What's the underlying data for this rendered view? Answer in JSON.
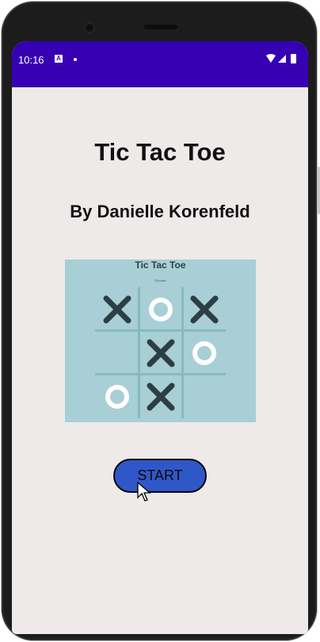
{
  "status_bar": {
    "time": "10:16",
    "notification_icon": "A",
    "icons": [
      "wifi-icon",
      "signal-icon",
      "battery-icon"
    ]
  },
  "app": {
    "title": "Tic Tac Toe",
    "subtitle": "By Danielle Korenfeld",
    "start_label": "START"
  },
  "preview": {
    "title": "Tic Tac Toe",
    "turn_text": "O's turn",
    "board": [
      "X",
      "O",
      "X",
      "",
      "X",
      "O",
      "O",
      "X",
      ""
    ]
  },
  "colors": {
    "status_bar": "#3700b3",
    "background": "#eeeae9",
    "preview_bg": "#a8cfd5",
    "mark_x": "#2d3e45",
    "mark_o": "#ffffff",
    "start_button": "#2f57c8"
  }
}
